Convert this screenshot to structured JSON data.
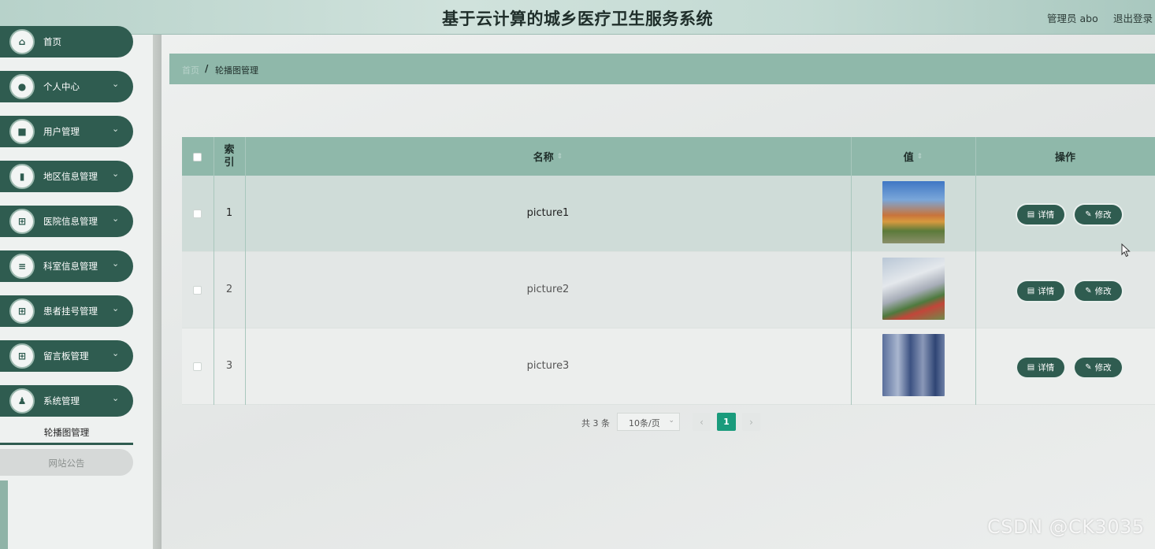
{
  "header": {
    "title": "基于云计算的城乡医疗卫生服务系统",
    "user_label": "管理员 abo",
    "logout_label": "退出登录"
  },
  "sidebar": {
    "items": [
      {
        "label": "首页",
        "icon": "home-icon"
      },
      {
        "label": "个人中心",
        "icon": "user-icon"
      },
      {
        "label": "用户管理",
        "icon": "briefcase-icon"
      },
      {
        "label": "地区信息管理",
        "icon": "clipboard-icon"
      },
      {
        "label": "医院信息管理",
        "icon": "grid-icon"
      },
      {
        "label": "科室信息管理",
        "icon": "list-icon"
      },
      {
        "label": "患者挂号管理",
        "icon": "grid-icon"
      },
      {
        "label": "留言板管理",
        "icon": "grid-icon"
      },
      {
        "label": "系统管理",
        "icon": "person-icon"
      }
    ],
    "sub_items": [
      {
        "label": "轮播图管理",
        "active": true
      },
      {
        "label": "网站公告",
        "active": false
      }
    ]
  },
  "breadcrumb": {
    "home": "首页",
    "separator": "/",
    "current": "轮播图管理"
  },
  "table": {
    "headers": {
      "index_line1": "索",
      "index_line2": "引",
      "name": "名称",
      "value": "值",
      "actions": "操作"
    },
    "rows": [
      {
        "index": "1",
        "name": "picture1",
        "detail_label": "详情",
        "edit_label": "修改"
      },
      {
        "index": "2",
        "name": "picture2",
        "detail_label": "详情",
        "edit_label": "修改"
      },
      {
        "index": "3",
        "name": "picture3",
        "detail_label": "详情",
        "edit_label": "修改"
      }
    ]
  },
  "pagination": {
    "total": "共 3 条",
    "page_size": "10条/页",
    "current_page": "1",
    "prev_symbol": "‹",
    "next_symbol": "›"
  },
  "watermark": "CSDN @CK3035",
  "colors": {
    "primary": "#2f5c50",
    "table_header": "#8fb8aa",
    "pagination_active": "#1a9b7c"
  }
}
